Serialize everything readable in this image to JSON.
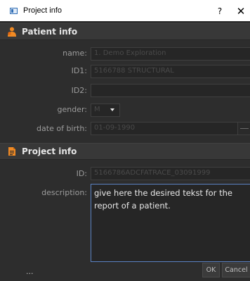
{
  "window": {
    "title": "Project info",
    "help_label": "?",
    "close_label": "✕"
  },
  "patient_section": {
    "header": "Patient info",
    "icon": "person-icon",
    "accent": "#f08a24",
    "name_label": "name:",
    "name_value": "1. Demo Exploration",
    "id1_label": "ID1:",
    "id1_value": "5166788 STRUCTURAL",
    "id2_label": "ID2:",
    "id2_value": "",
    "gender_label": "gender:",
    "gender_value": "M",
    "dob_label": "date of birth:",
    "dob_value": "01-09-1990"
  },
  "project_section": {
    "header": "Project info",
    "icon": "document-icon",
    "id_label": "ID:",
    "id_value": "5166786ADCFATRACE_03091999",
    "description_label": "description:",
    "description_value": "give here the desired tekst for the report of a patient."
  },
  "footer": {
    "more_label": "...",
    "ok_label": "OK",
    "cancel_label": "Cancel"
  }
}
